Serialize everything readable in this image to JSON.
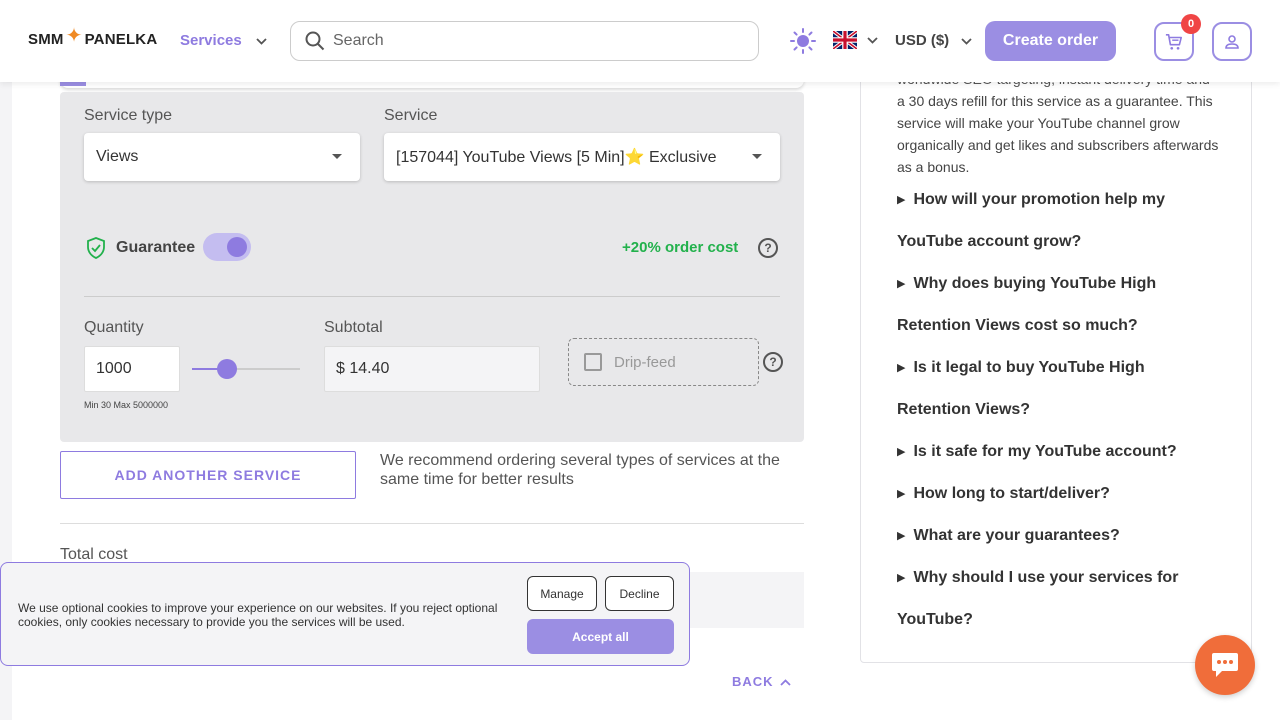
{
  "header": {
    "logo_left": "SMM",
    "logo_right": "PANELKA",
    "nav_services": "Services",
    "search_placeholder": "Search",
    "currency": "USD ($)",
    "create_order": "Create order",
    "cart_count": "0"
  },
  "form": {
    "service_type_label": "Service type",
    "service_type_value": "Views",
    "service_label": "Service",
    "service_value": "[157044] YouTube Views [5 Min]⭐ Exclusive",
    "guarantee_label": "Guarantee",
    "guarantee_on": true,
    "guarantee_cost": "+20% order cost",
    "quantity_label": "Quantity",
    "quantity_value": "1000",
    "quantity_minmax": "Min 30 Max 5000000",
    "subtotal_label": "Subtotal",
    "subtotal_value": "$ 14.40",
    "dripfeed_label": "Drip-feed",
    "help_glyph": "?",
    "add_service": "ADD ANOTHER SERVICE",
    "recommend_text": "We recommend ordering several types of services at the same time for better results",
    "total_cost_label": "Total cost",
    "back": "BACK"
  },
  "faq": {
    "intro_line1": "worldwide SEO targeting, instant delivery time and",
    "intro_rest": "a 30 days refill for this service as a guarantee. This service will make your YouTube channel grow organically and get likes and subscribers afterwards as a bonus.",
    "items": [
      "How will your promotion help my YouTube account grow?",
      "Why does buying YouTube High Retention Views cost so much?",
      "Is it legal to buy YouTube High Retention Views?",
      "Is it safe for my YouTube account?",
      "How long to start/deliver?",
      "What are your guarantees?",
      "Why should I use your services for YouTube?"
    ]
  },
  "cookie": {
    "text": "We use optional cookies to improve your experience on our websites. If you reject optional cookies, only cookies necessary to provide you the services will be used.",
    "manage": "Manage",
    "decline": "Decline",
    "accept": "Accept all"
  },
  "colors": {
    "accent": "#9b8ee3",
    "success": "#22b14c",
    "chat": "#f06d3a",
    "badge": "#f04545"
  },
  "icons": [
    "sun-icon",
    "uk-flag-icon",
    "cart-icon",
    "user-icon",
    "search-icon",
    "shield-icon",
    "help-icon",
    "chat-icon"
  ]
}
